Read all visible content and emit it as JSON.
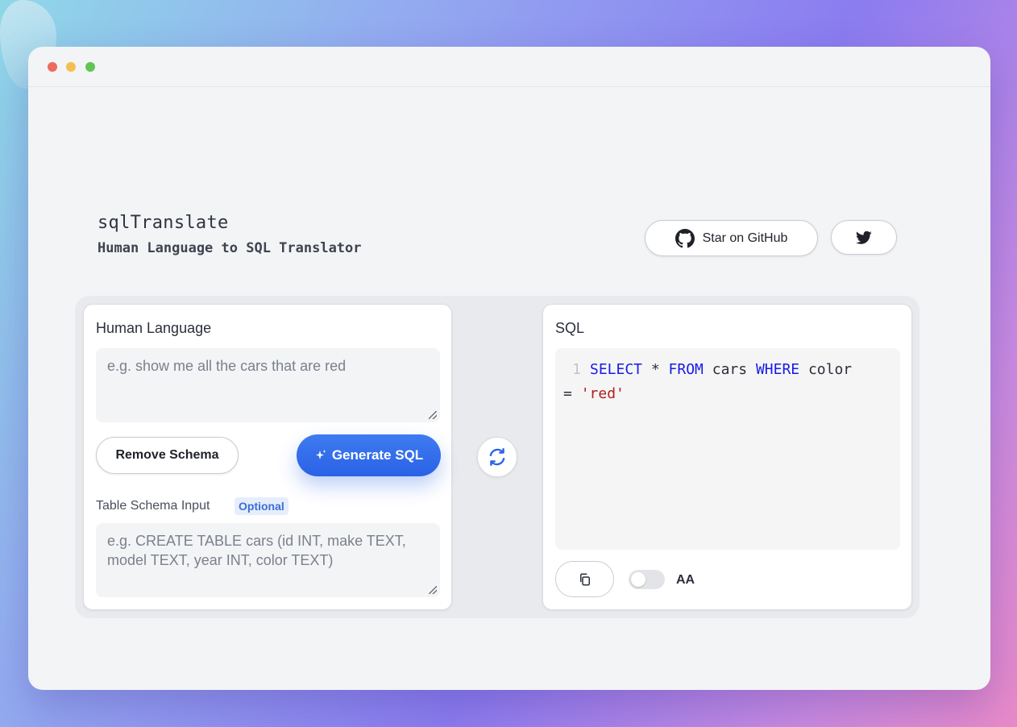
{
  "app": {
    "title": "sqlTranslate",
    "subtitle": "Human Language to SQL Translator"
  },
  "header": {
    "github_label": "Star on GitHub",
    "github_icon": "github-icon",
    "twitter_icon": "twitter-icon"
  },
  "left_card": {
    "heading": "Human Language",
    "input_placeholder": "e.g. show me all the cars that are red",
    "remove_schema_label": "Remove Schema",
    "generate_label": "Generate SQL",
    "generate_icon": "sparkle-icon",
    "schema_label": "Table Schema Input",
    "optional_badge": "Optional",
    "schema_placeholder": "e.g. CREATE TABLE cars (id INT, make TEXT, model TEXT, year INT, color TEXT)"
  },
  "swap_icon": "swap-arrows-icon",
  "right_card": {
    "heading": "SQL",
    "line_number": "1",
    "code": {
      "kw_select": "SELECT",
      "star": " * ",
      "kw_from": "FROM",
      "table": " cars ",
      "kw_where": "WHERE",
      "column": " color",
      "eq": "= ",
      "value": "'red'"
    },
    "copy_icon": "copy-icon",
    "toggle_label": "AA"
  },
  "colors": {
    "primary_button": "#2a62e6",
    "keyword": "#1a1ae6",
    "string": "#b0201a"
  }
}
